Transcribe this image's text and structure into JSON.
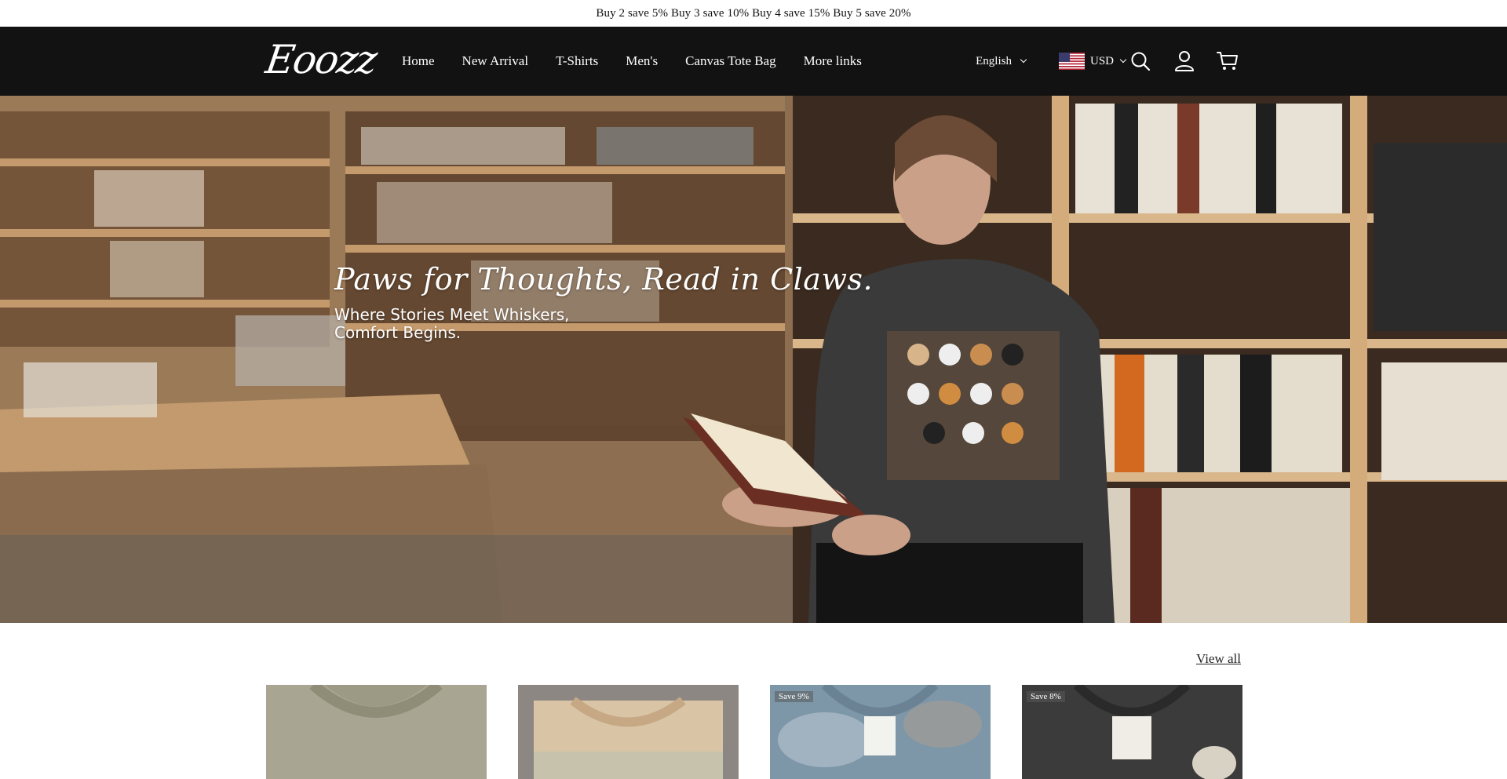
{
  "announcement": "Buy 2 save 5% Buy 3 save 10% Buy 4 save 15% Buy 5 save 20%",
  "header": {
    "logo": "Eoozz",
    "nav": [
      "Home",
      "New Arrival",
      "T-Shirts",
      "Men's",
      "Canvas Tote Bag",
      "More links"
    ],
    "language": "English",
    "currency": "USD",
    "icons": [
      "search-icon",
      "account-icon",
      "cart-icon"
    ]
  },
  "hero": {
    "title": "Paws for Thoughts, Read in Claws.",
    "subtitle_line1": "Where Stories Meet Whiskers,",
    "subtitle_line2": "Comfort Begins."
  },
  "collection": {
    "view_all": "View all",
    "products": [
      {
        "badge": "",
        "color": "#a8a592"
      },
      {
        "badge": "",
        "color": "#c9b79b"
      },
      {
        "badge": "Save 9%",
        "color": "#7d97a8"
      },
      {
        "badge": "Save 8%",
        "color": "#3b3b3b"
      }
    ]
  }
}
